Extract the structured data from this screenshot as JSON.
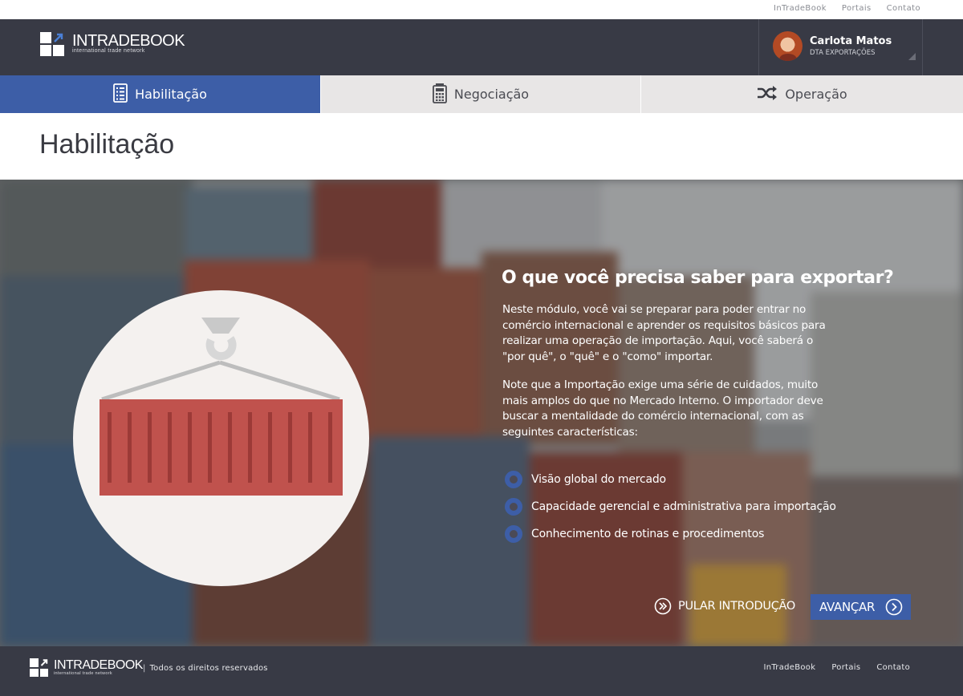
{
  "top_links": [
    "InTradeBook",
    "Portais",
    "Contato"
  ],
  "brand": {
    "name": "INTRADEBOOK",
    "tagline": "international trade network"
  },
  "user": {
    "name": "Carlota Matos",
    "role": "DTA EXPORTAÇÕES"
  },
  "tabs": [
    {
      "label": "Habilitação",
      "icon": "checklist-icon",
      "active": true
    },
    {
      "label": "Negociação",
      "icon": "calculator-icon",
      "active": false
    },
    {
      "label": "Operação",
      "icon": "shuffle-icon",
      "active": false
    }
  ],
  "page": {
    "title": "Habilitação"
  },
  "intro": {
    "heading": "O que você precisa saber para exportar?",
    "paragraph_1": "Neste módulo, você vai se preparar para poder entrar no comércio internacional e aprender os requisitos básicos para realizar uma operação de importação. Aqui, você saberá o \"por quê\", o \"quê\" e o \"como\" importar.",
    "paragraph_2": "Note que a Importação exige uma série de cuidados, muito mais amplos do que no Mercado Interno. O importador deve buscar a mentalidade do comércio internacional, com as seguintes características:",
    "bullets": [
      "Visão global do mercado",
      "Capacidade gerencial e administrativa para importação",
      "Conhecimento de rotinas e procedimentos"
    ],
    "illustration": "shipping-container-crane-icon"
  },
  "actions": {
    "skip_label": "PULAR INTRODUÇÃO",
    "next_label": "AVANÇAR"
  },
  "footer": {
    "rights": "Todos os direitos reservados",
    "links": [
      "InTradeBook",
      "Portais",
      "Contato"
    ]
  },
  "colors": {
    "primary_blue": "#3d5ea7",
    "header_dark": "#383a45",
    "tab_inactive": "#e8e6e6",
    "container_red": "#c0524d"
  }
}
